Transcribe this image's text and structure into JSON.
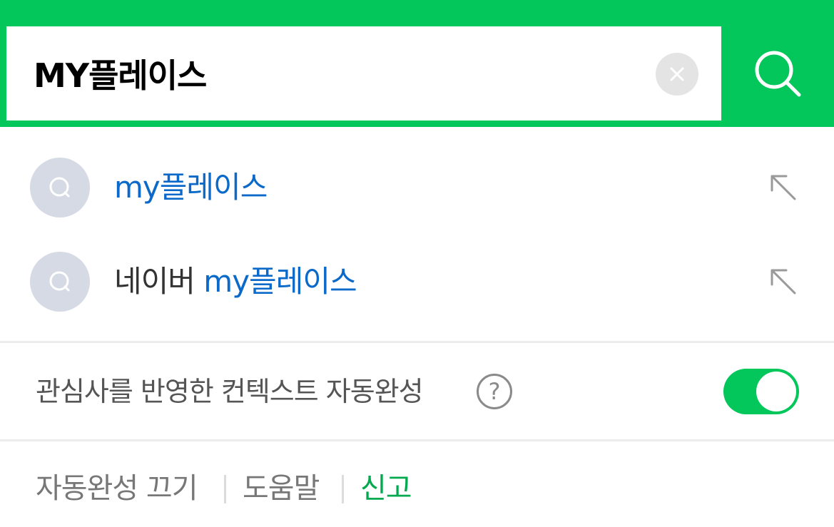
{
  "search": {
    "value": "MY플레이스",
    "clear_icon": "close-icon",
    "search_icon": "search-icon"
  },
  "suggestions": [
    {
      "prefix": "",
      "match": "my플레이스",
      "icon": "search-icon",
      "action_icon": "arrow-up-left-icon"
    },
    {
      "prefix": "네이버 ",
      "match": "my플레이스",
      "icon": "search-icon",
      "action_icon": "arrow-up-left-icon"
    }
  ],
  "context": {
    "label": "관심사를 반영한 컨텍스트 자동완성",
    "help_text": "?",
    "toggle_on": true
  },
  "footer": {
    "disable_label": "자동완성 끄기",
    "help_label": "도움말",
    "report_label": "신고"
  },
  "colors": {
    "brand_green": "#03c75a",
    "match_blue": "#0b6ac9",
    "report_green": "#03a94f"
  }
}
